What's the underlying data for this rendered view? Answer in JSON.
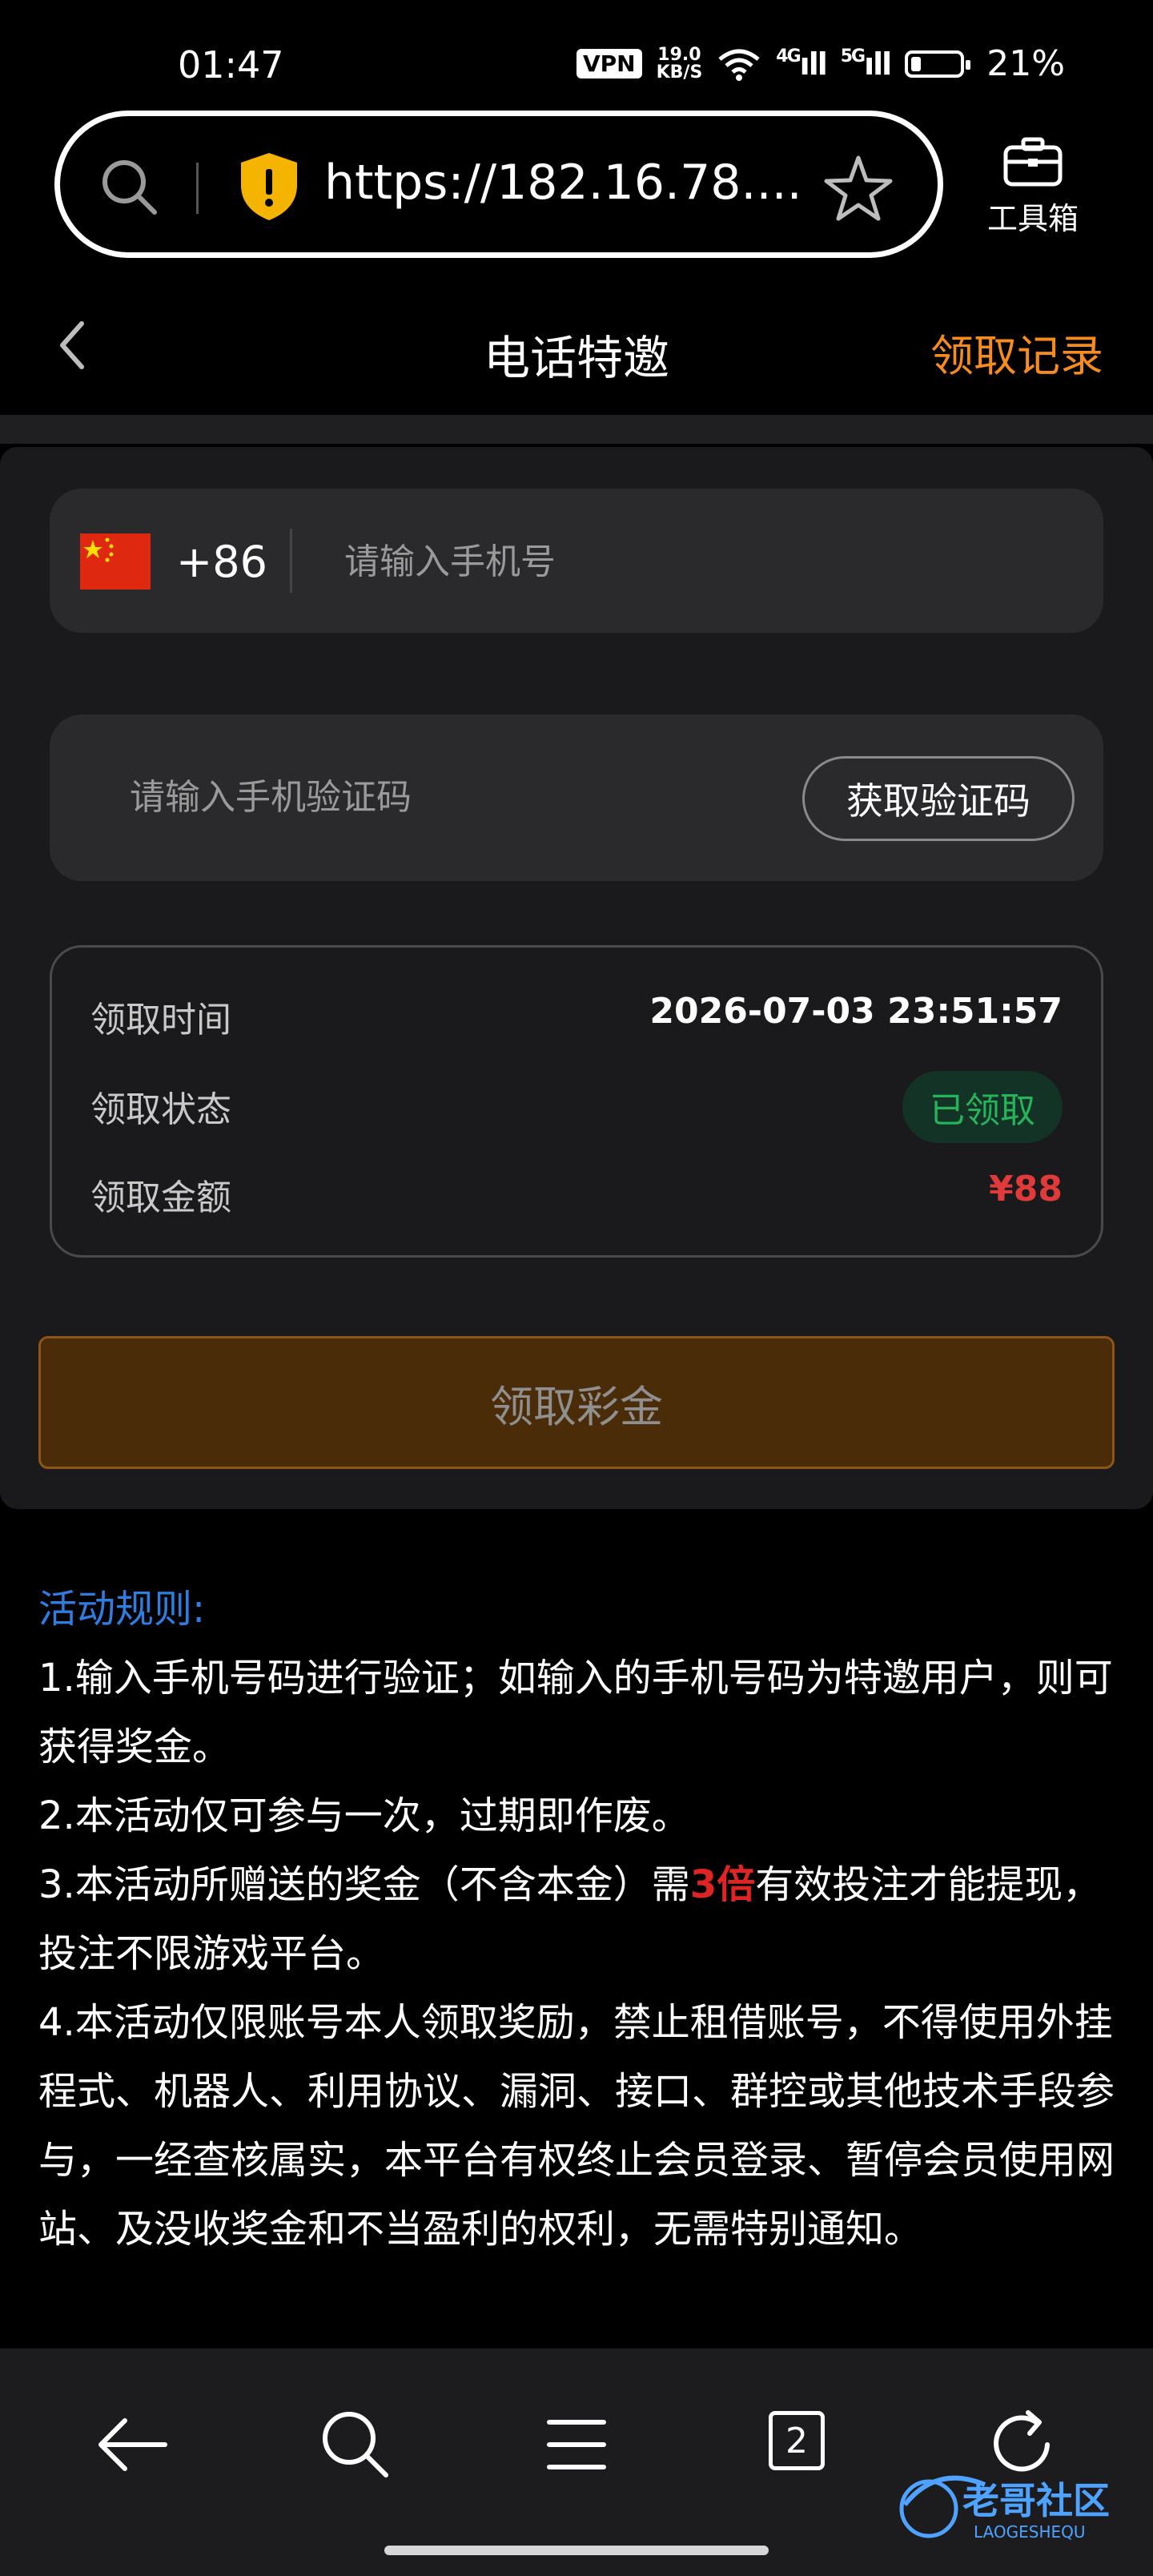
{
  "status_bar": {
    "time": "01:47",
    "vpn": "VPN",
    "net_speed_value": "19.0",
    "net_speed_unit": "KB/S",
    "signal_4g": "4G",
    "signal_5g": "5G",
    "battery_percent": "21%",
    "battery_level": 0.21
  },
  "browser": {
    "url": "https://182.16.78....",
    "toolbox_label": "工具箱"
  },
  "header": {
    "title": "电话特邀",
    "records_link": "领取记录"
  },
  "form": {
    "dial_code": "+86",
    "phone_placeholder": "请输入手机号",
    "code_placeholder": "请输入手机验证码",
    "get_code_label": "获取验证码"
  },
  "info": {
    "time_label": "领取时间",
    "time_value": "2026-07-03 23:51:57",
    "status_label": "领取状态",
    "status_value": "已领取",
    "amount_label": "领取金额",
    "amount_value": "¥88"
  },
  "claim_button": "领取彩金",
  "rules": {
    "title": "活动规则:",
    "rule1": "1.输入手机号码进行验证；如输入的手机号码为特邀用户，则可获得奖金。",
    "rule2": "2.本活动仅可参与一次，过期即作废。",
    "rule3_before": "3.本活动所赠送的奖金（不含本金）需",
    "rule3_highlight": "3倍",
    "rule3_after": "有效投注才能提现，投注不限游戏平台。",
    "rule4": "4.本活动仅限账号本人领取奖励，禁止租借账号，不得使用外挂程式、机器人、利用协议、漏洞、接口、群控或其他技术手段参与，一经查核属实，本平台有权终止会员登录、暂停会员使用网站、及没收奖金和不当盈利的权利，无需特别通知。"
  },
  "bottom_nav": {
    "tab_count": "2",
    "watermark_text": "老哥社区",
    "watermark_sub": "LAOGESHEQU"
  },
  "colors": {
    "accent_orange": "#f68b1e",
    "success_green": "#27b35a",
    "amount_red": "#e03a3a",
    "rules_blue": "#2f7de0"
  }
}
